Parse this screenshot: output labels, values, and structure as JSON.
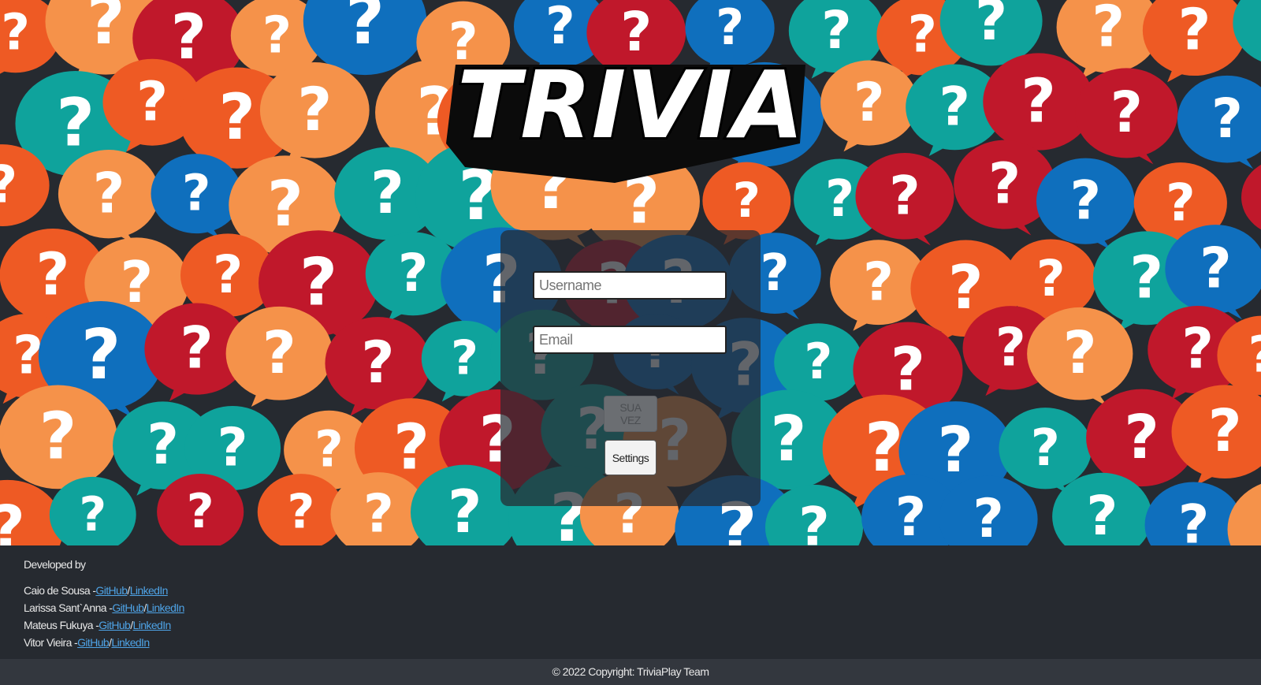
{
  "logo": {
    "text": "TRIVIA"
  },
  "login": {
    "username_placeholder": "Username",
    "email_placeholder": "Email",
    "play_label": "SUA VEZ",
    "settings_label": "Settings"
  },
  "credits": {
    "title": "Developed by",
    "developers": [
      {
        "name": "Caio de Sousa -",
        "github": "GitHub",
        "sep": "/",
        "linkedin": "LinkedIn"
      },
      {
        "name": "Larissa Sant`Anna -",
        "github": "GitHub",
        "sep": "/",
        "linkedin": "LinkedIn"
      },
      {
        "name": "Mateus Fukuya -",
        "github": "GitHub",
        "sep": "/",
        "linkedin": "LinkedIn"
      },
      {
        "name": "Vitor Vieira -",
        "github": "GitHub",
        "sep": "/",
        "linkedin": "LinkedIn"
      }
    ]
  },
  "footer": {
    "copyright": "© 2022 Copyright: TriviaPlay Team"
  },
  "colors": {
    "background": "#262a30",
    "bubble_red": "#c0182b",
    "bubble_orange": "#ee5a24",
    "bubble_light_orange": "#f5924a",
    "bubble_teal": "#0fa39c",
    "bubble_blue": "#0f6fbd",
    "link": "#4ea3e6"
  }
}
